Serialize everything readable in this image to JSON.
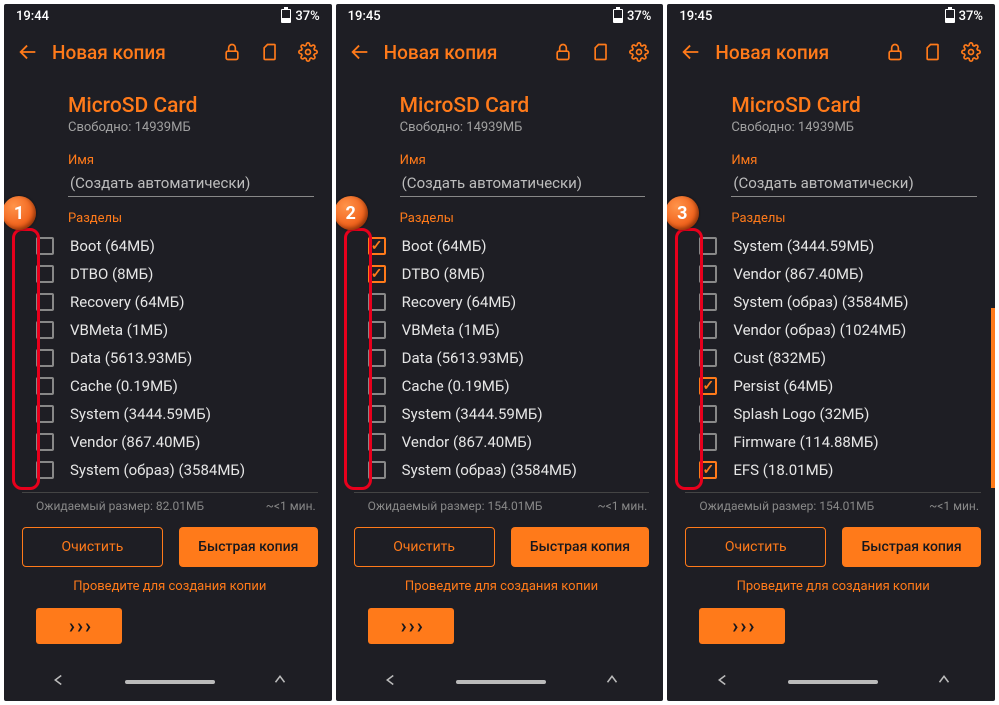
{
  "statusbar": {
    "time": "19:44",
    "time2": "19:45",
    "time3": "19:45",
    "battery": "37%"
  },
  "header": {
    "title": "Новая копия"
  },
  "storage": {
    "title": "MicroSD Card",
    "free": "Свободно: 14939МБ"
  },
  "name": {
    "label": "Имя",
    "placeholder": "(Создать автоматически)"
  },
  "partitions_label": "Разделы",
  "screens": [
    {
      "badge": "1",
      "items": [
        {
          "label": "Boot (64МБ)",
          "checked": false
        },
        {
          "label": "DTBO (8МБ)",
          "checked": false
        },
        {
          "label": "Recovery (64МБ)",
          "checked": false
        },
        {
          "label": "VBMeta (1МБ)",
          "checked": false
        },
        {
          "label": "Data (5613.93МБ)",
          "checked": false
        },
        {
          "label": "Cache (0.19МБ)",
          "checked": false
        },
        {
          "label": "System (3444.59МБ)",
          "checked": false
        },
        {
          "label": "Vendor (867.40МБ)",
          "checked": false
        },
        {
          "label": "System (образ) (3584МБ)",
          "checked": false
        }
      ],
      "estimate_size": "Ожидаемый размер:  82.01МБ",
      "estimate_time": "~<1 мин."
    },
    {
      "badge": "2",
      "items": [
        {
          "label": "Boot (64МБ)",
          "checked": true
        },
        {
          "label": "DTBO (8МБ)",
          "checked": true
        },
        {
          "label": "Recovery (64МБ)",
          "checked": false
        },
        {
          "label": "VBMeta (1МБ)",
          "checked": false
        },
        {
          "label": "Data (5613.93МБ)",
          "checked": false
        },
        {
          "label": "Cache (0.19МБ)",
          "checked": false
        },
        {
          "label": "System (3444.59МБ)",
          "checked": false
        },
        {
          "label": "Vendor (867.40МБ)",
          "checked": false
        },
        {
          "label": "System (образ) (3584МБ)",
          "checked": false
        }
      ],
      "estimate_size": "Ожидаемый размер:  154.01МБ",
      "estimate_time": "~<1 мин."
    },
    {
      "badge": "3",
      "items": [
        {
          "label": "System (3444.59МБ)",
          "checked": false
        },
        {
          "label": "Vendor (867.40МБ)",
          "checked": false
        },
        {
          "label": "System (образ) (3584МБ)",
          "checked": false
        },
        {
          "label": "Vendor (образ) (1024МБ)",
          "checked": false
        },
        {
          "label": "Cust (832МБ)",
          "checked": false
        },
        {
          "label": "Persist (64МБ)",
          "checked": true
        },
        {
          "label": "Splash Logo (32МБ)",
          "checked": false
        },
        {
          "label": "Firmware (114.88МБ)",
          "checked": false
        },
        {
          "label": "EFS (18.01МБ)",
          "checked": true
        }
      ],
      "estimate_size": "Ожидаемый размер:  154.01МБ",
      "estimate_time": "~<1 мин."
    }
  ],
  "buttons": {
    "clear": "Очистить",
    "quick": "Быстрая копия"
  },
  "swipe_hint": "Проведите для создания копии"
}
